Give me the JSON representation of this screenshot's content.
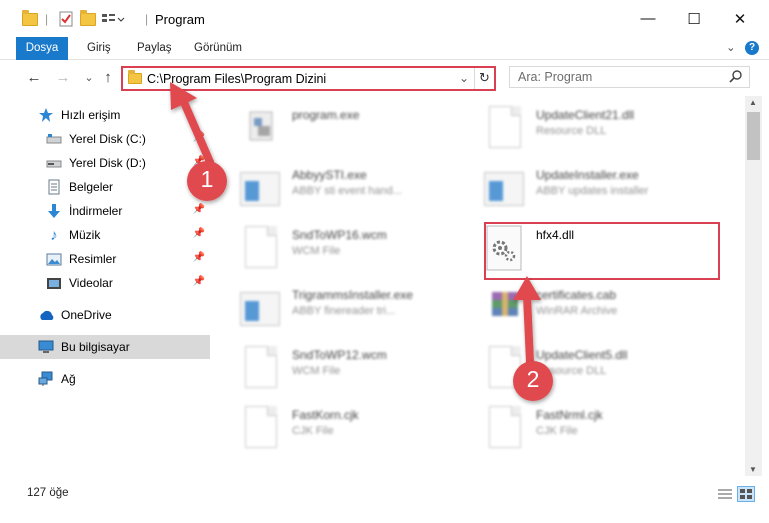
{
  "window": {
    "title": "Program",
    "minimize": "—",
    "maximize": "☐",
    "close": "✕"
  },
  "ribbon": {
    "tabs": [
      "Dosya",
      "Giriş",
      "Paylaş",
      "Görünüm"
    ],
    "collapse": "⌄",
    "help": "?"
  },
  "navigation": {
    "back": "←",
    "forward": "→",
    "recent": "⌄",
    "up": "↑",
    "address": "C:\\Program Files\\Program Dizini",
    "refresh": "↻",
    "search_placeholder": "Ara: Program"
  },
  "sidebar": {
    "items": [
      {
        "label": "Hızlı erişim",
        "icon": "star-icon"
      },
      {
        "label": "Yerel Disk (C:)",
        "icon": "drive-icon"
      },
      {
        "label": "Yerel Disk (D:)",
        "icon": "drive-icon"
      },
      {
        "label": "Belgeler",
        "icon": "documents-icon"
      },
      {
        "label": "İndirmeler",
        "icon": "download-icon"
      },
      {
        "label": "Müzik",
        "icon": "music-icon"
      },
      {
        "label": "Resimler",
        "icon": "pictures-icon"
      },
      {
        "label": "Videolar",
        "icon": "video-icon"
      },
      {
        "label": "OneDrive",
        "icon": "cloud-icon"
      },
      {
        "label": "Bu bilgisayar",
        "icon": "computer-icon"
      },
      {
        "label": "Ağ",
        "icon": "network-icon"
      }
    ]
  },
  "files": [
    {
      "name": "program.exe",
      "desc": ""
    },
    {
      "name": "UpdateClient21.dll",
      "desc": "Resource DLL"
    },
    {
      "name": "AbbyySTI.exe",
      "desc": "ABBY sti event hand..."
    },
    {
      "name": "UpdateInstaller.exe",
      "desc": "ABBY updates installer"
    },
    {
      "name": "SndToWP16.wcm",
      "desc": "WCM File"
    },
    {
      "name": "hfx4.dll",
      "desc": ""
    },
    {
      "name": "TrigrammsInstaller.exe",
      "desc": "ABBY finereader tri..."
    },
    {
      "name": "certificates.cab",
      "desc": "WinRAR Archive"
    },
    {
      "name": "SndToWP12.wcm",
      "desc": "WCM File"
    },
    {
      "name": "UpdateClient5.dll",
      "desc": "Resource DLL"
    },
    {
      "name": "FastKorn.cjk",
      "desc": "CJK File"
    },
    {
      "name": "FastNrml.cjk",
      "desc": "CJK File"
    }
  ],
  "annotations": {
    "step1": "1",
    "step2": "2"
  },
  "status": {
    "count": "127 öğe"
  },
  "colors": {
    "accent": "#1979ca",
    "highlight": "#d94152",
    "selected": "#d9d9d9"
  }
}
